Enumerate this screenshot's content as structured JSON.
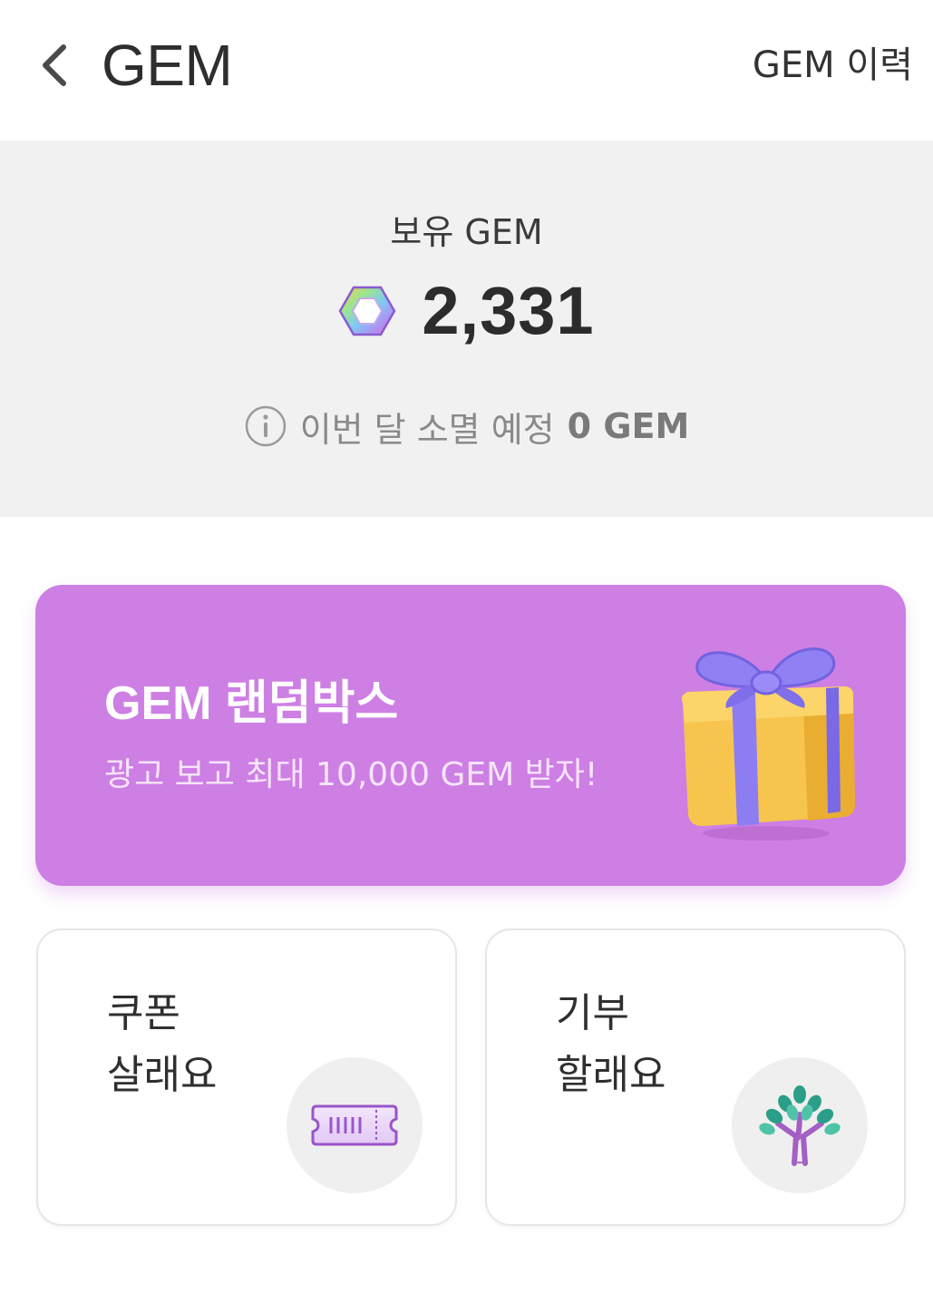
{
  "header": {
    "title": "GEM",
    "history_label": "GEM 이력"
  },
  "balance": {
    "label": "보유 GEM",
    "amount": "2,331",
    "expire_text": "이번 달 소멸 예정",
    "expire_value": "0 GEM"
  },
  "randombox": {
    "title": "GEM 랜덤박스",
    "subtitle": "광고 보고 최대 10,000 GEM 받자!"
  },
  "actions": [
    {
      "line1": "쿠폰",
      "line2": "살래요",
      "icon": "ticket-icon"
    },
    {
      "line1": "기부",
      "line2": "할래요",
      "icon": "tree-icon"
    }
  ],
  "colors": {
    "banner": "#cd7fe4",
    "panel_bg": "#f1f1f1",
    "ribbon": "#8b7cf0",
    "gift_box": "#f7c24c"
  }
}
